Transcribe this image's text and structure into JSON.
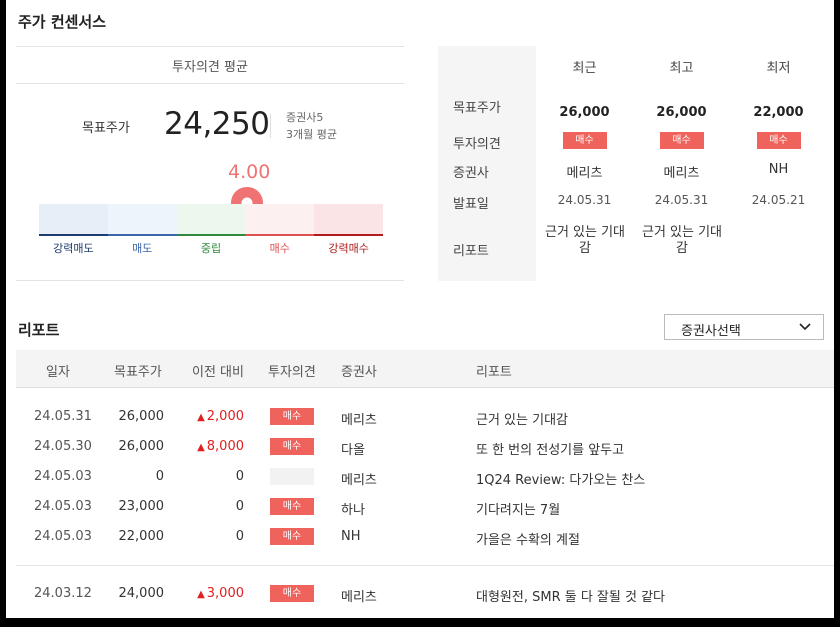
{
  "header": {
    "title": "주가 컨센서스"
  },
  "consensus": {
    "subtitle": "투자의견 평균",
    "target_label": "목표주가",
    "target_value": "24,250",
    "brokers_count": "증권사5",
    "period": "3개월 평균",
    "score": "4.00",
    "score_value": 4.0,
    "gauge_labels": [
      "강력매도",
      "매도",
      "중립",
      "매수",
      "강력매수"
    ],
    "gauge_colors": [
      "#e7eef8",
      "#eef4fb",
      "#eef7ee",
      "#fdf0f0",
      "#fbe4e6"
    ],
    "gauge_label_colors": [
      "#1d3b6e",
      "#3a66aa",
      "#2e8a3a",
      "#e05050",
      "#b01c1c"
    ],
    "gauge_base_colors": [
      "#1d3b6e",
      "#3a66aa",
      "#2e8a3a",
      "#e05050",
      "#b01c1c"
    ]
  },
  "summary": {
    "columns": [
      "최근",
      "최고",
      "최저"
    ],
    "row_labels": {
      "target": "목표주가",
      "opinion": "투자의견",
      "broker": "증권사",
      "date": "발표일",
      "report": "리포트"
    },
    "latest": {
      "target": "26,000",
      "opinion": "매수",
      "broker": "메리츠",
      "date": "24.05.31",
      "report": "근거 있는 기대감"
    },
    "highest": {
      "target": "26,000",
      "opinion": "매수",
      "broker": "메리츠",
      "date": "24.05.31",
      "report": "근거 있는 기대감"
    },
    "lowest": {
      "target": "22,000",
      "opinion": "매수",
      "broker": "NH",
      "date": "24.05.21",
      "report": ""
    }
  },
  "reports": {
    "title": "리포트",
    "broker_select": "증권사선택",
    "headers": [
      "일자",
      "목표주가",
      "이전 대비",
      "투자의견",
      "증권사",
      "리포트"
    ],
    "rows": [
      {
        "date": "24.05.31",
        "target": "26,000",
        "diff": "2,000",
        "diff_dir": "up",
        "opinion": "매수",
        "broker": "메리츠",
        "title": "근거 있는 기대감"
      },
      {
        "date": "24.05.30",
        "target": "26,000",
        "diff": "8,000",
        "diff_dir": "up",
        "opinion": "매수",
        "broker": "다올",
        "title": "또 한 번의 전성기를 앞두고"
      },
      {
        "date": "24.05.03",
        "target": "0",
        "diff": "0",
        "diff_dir": "none",
        "opinion": "",
        "broker": "메리츠",
        "title": "1Q24 Review: 다가오는 찬스"
      },
      {
        "date": "24.05.03",
        "target": "23,000",
        "diff": "0",
        "diff_dir": "none",
        "opinion": "매수",
        "broker": "하나",
        "title": "기다려지는 7월"
      },
      {
        "date": "24.05.03",
        "target": "22,000",
        "diff": "0",
        "diff_dir": "none",
        "opinion": "매수",
        "broker": "NH",
        "title": "가을은 수확의 계절"
      },
      {
        "date": "24.03.12",
        "target": "24,000",
        "diff": "3,000",
        "diff_dir": "up",
        "opinion": "매수",
        "broker": "메리츠",
        "title": "대형원전, SMR 둘 다 잘될 것 같다"
      }
    ]
  }
}
